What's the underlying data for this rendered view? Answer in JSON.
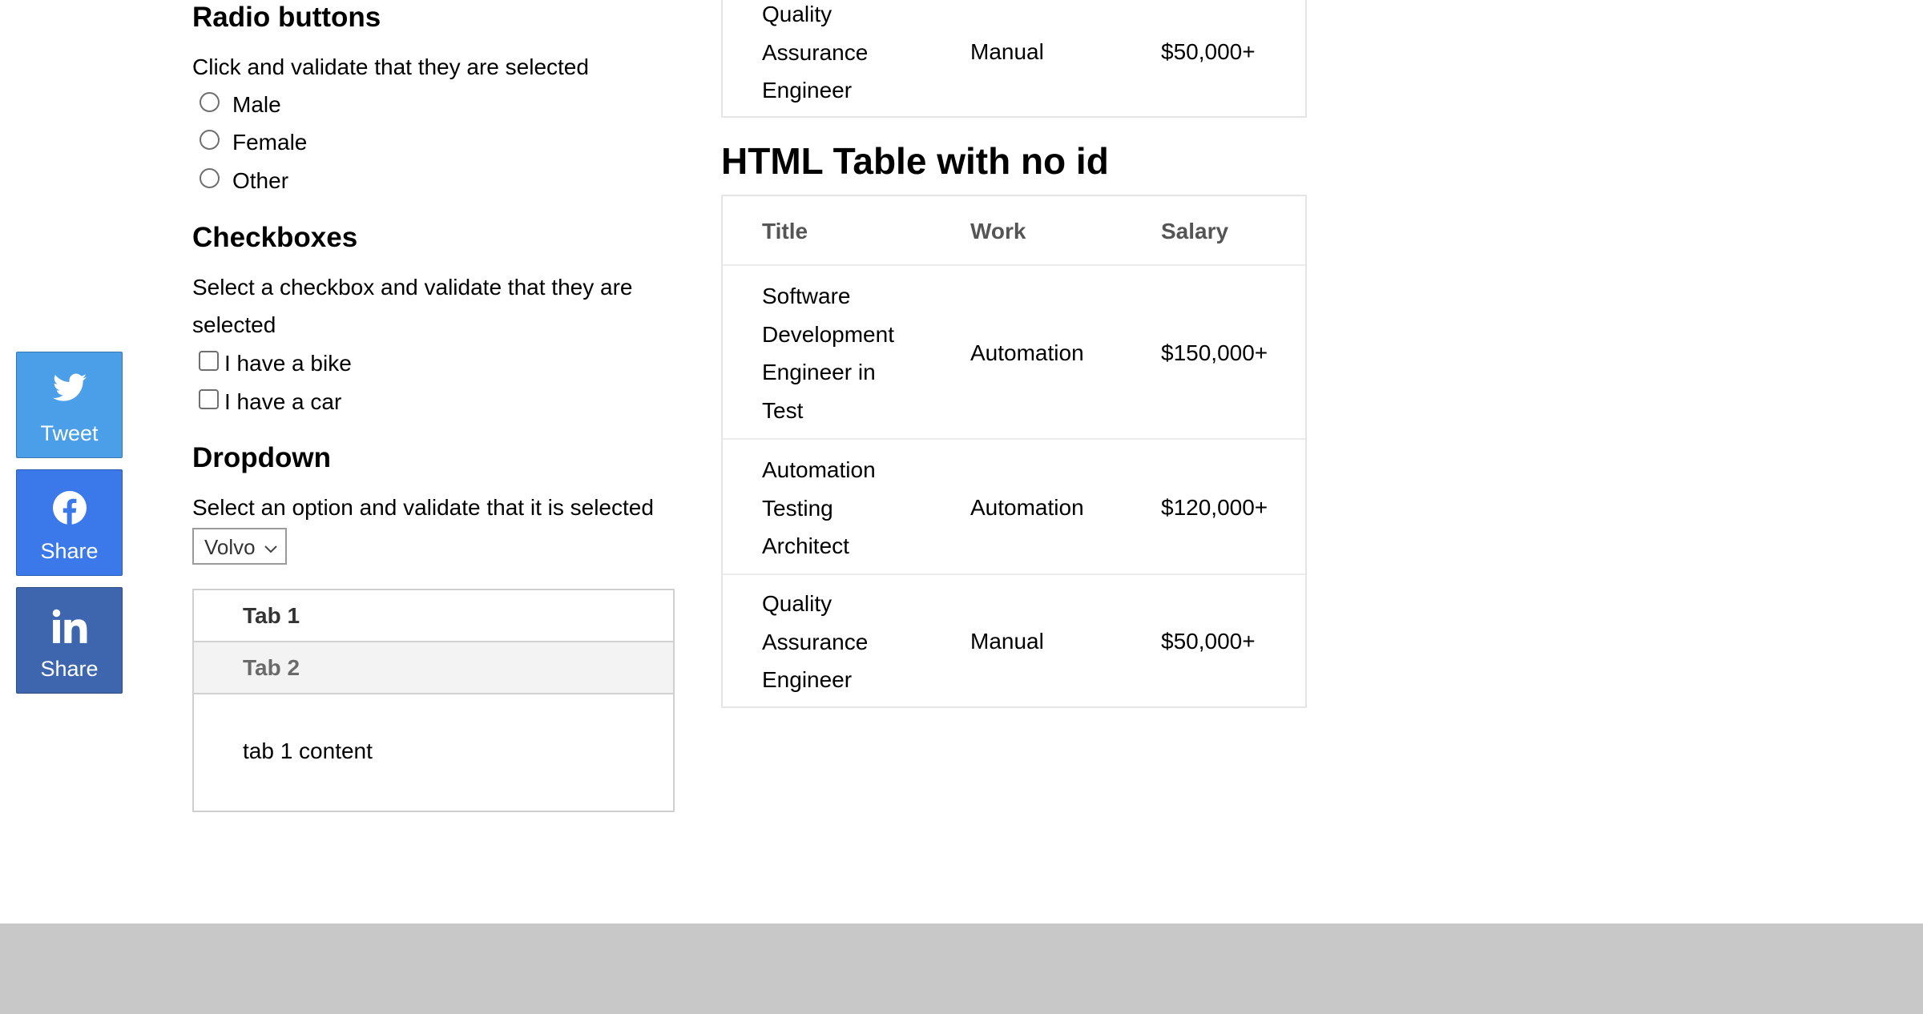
{
  "social": {
    "tweet": {
      "label": "Tweet",
      "icon": "twitter-icon",
      "color": "#4b9fe9"
    },
    "facebook": {
      "label": "Share",
      "icon": "facebook-icon",
      "color": "#3b78ea"
    },
    "linkedin": {
      "label": "Share",
      "icon": "linkedin-icon",
      "color": "#3d66ae"
    }
  },
  "radio": {
    "heading": "Radio buttons",
    "description": "Click and validate that they are selected",
    "options": [
      "Male",
      "Female",
      "Other"
    ]
  },
  "checkboxes": {
    "heading": "Checkboxes",
    "description_line1": "Select a checkbox and validate that they are",
    "description_line2": "selected",
    "options": [
      "I have a bike",
      "I have a car"
    ]
  },
  "dropdown": {
    "heading": "Dropdown",
    "description": "Select an option and validate that it is selected",
    "selected": "Volvo"
  },
  "tabs": {
    "items": [
      "Tab 1",
      "Tab 2"
    ],
    "active": "Tab 1",
    "content": "tab 1 content"
  },
  "table_top_partial": {
    "row": {
      "title_lines": [
        "Quality",
        "Assurance",
        "Engineer"
      ],
      "work": "Manual",
      "salary": "$50,000+"
    }
  },
  "table_no_id": {
    "heading": "HTML Table with no id",
    "headers": [
      "Title",
      "Work",
      "Salary"
    ],
    "rows": [
      {
        "title_lines": [
          "Software",
          "Development",
          "Engineer in",
          "Test"
        ],
        "work": "Automation",
        "salary": "$150,000+"
      },
      {
        "title_lines": [
          "Automation",
          "Testing",
          "Architect"
        ],
        "work": "Automation",
        "salary": "$120,000+"
      },
      {
        "title_lines": [
          "Quality",
          "Assurance",
          "Engineer"
        ],
        "work": "Manual",
        "salary": "$50,000+"
      }
    ]
  },
  "colors": {
    "footer": "#c8c8c8",
    "tab_inactive": "#f3f3f3"
  }
}
